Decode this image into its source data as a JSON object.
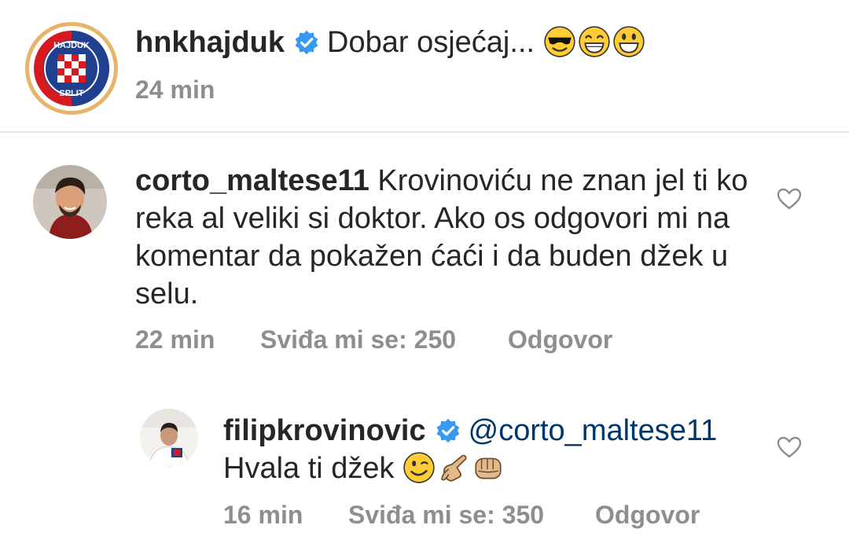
{
  "post_caption": {
    "username": "hnkhajduk",
    "text": "Dobar osjećaj...",
    "emojis": [
      "smiling-face-with-sunglasses-icon",
      "grinning-face-icon",
      "grinning-face-big-eyes-icon"
    ],
    "time": "24 min",
    "logo_text_top": "HAJDUK",
    "logo_text_bottom": "SPLIT"
  },
  "comments": [
    {
      "username": "corto_maltese11",
      "text": "Krovinoviću ne znan jel ti ko reka al veliki si doktor. Ako os odgovori mi na komentar da pokažen ćaći i da buden džek u selu.",
      "time": "22 min",
      "likes": "Sviđa mi se: 250",
      "reply": "Odgovor"
    },
    {
      "username": "filipkrovinovic",
      "mention": "@corto_maltese11",
      "text": "Hvala ti džek",
      "emojis": [
        "winking-face-icon",
        "call-me-hand-icon",
        "oncoming-fist-icon"
      ],
      "time": "16 min",
      "likes": "Sviđa mi se: 350",
      "reply": "Odgovor"
    }
  ],
  "colors": {
    "verified": "#3897f0",
    "meta_gray": "#8e8e8e",
    "mention": "#00376b"
  }
}
